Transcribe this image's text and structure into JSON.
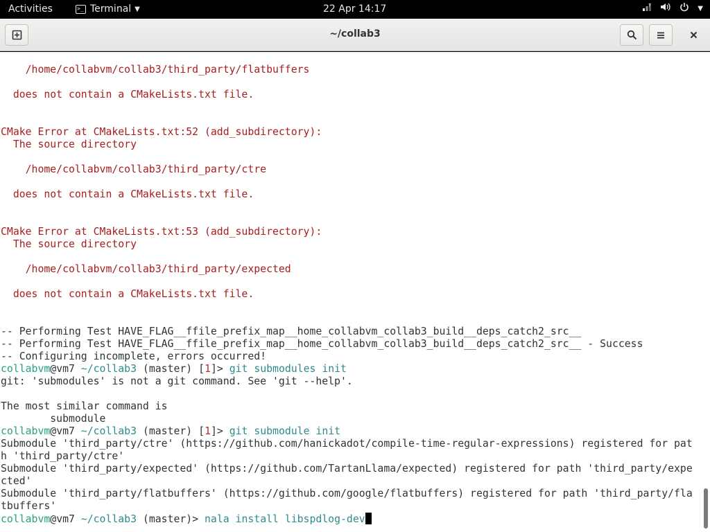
{
  "topbar": {
    "activities": "Activities",
    "app_menu_label": "Terminal",
    "clock": "22 Apr  14:17",
    "icons": [
      "network-icon",
      "volume-icon",
      "power-icon"
    ]
  },
  "window": {
    "title": "~/collab3"
  },
  "terminal": {
    "lines": [
      {
        "segs": [
          {
            "t": "    /home/collabvm/collab3/third_party/flatbuffers",
            "c": "err"
          }
        ]
      },
      {
        "segs": []
      },
      {
        "segs": [
          {
            "t": "  does not contain a CMakeLists.txt file.",
            "c": "err"
          }
        ]
      },
      {
        "segs": []
      },
      {
        "segs": []
      },
      {
        "segs": [
          {
            "t": "CMake Error at CMakeLists.txt:52 (add_subdirectory):",
            "c": "err"
          }
        ]
      },
      {
        "segs": [
          {
            "t": "  The source directory",
            "c": "err"
          }
        ]
      },
      {
        "segs": []
      },
      {
        "segs": [
          {
            "t": "    /home/collabvm/collab3/third_party/ctre",
            "c": "err"
          }
        ]
      },
      {
        "segs": []
      },
      {
        "segs": [
          {
            "t": "  does not contain a CMakeLists.txt file.",
            "c": "err"
          }
        ]
      },
      {
        "segs": []
      },
      {
        "segs": []
      },
      {
        "segs": [
          {
            "t": "CMake Error at CMakeLists.txt:53 (add_subdirectory):",
            "c": "err"
          }
        ]
      },
      {
        "segs": [
          {
            "t": "  The source directory",
            "c": "err"
          }
        ]
      },
      {
        "segs": []
      },
      {
        "segs": [
          {
            "t": "    /home/collabvm/collab3/third_party/expected",
            "c": "err"
          }
        ]
      },
      {
        "segs": []
      },
      {
        "segs": [
          {
            "t": "  does not contain a CMakeLists.txt file.",
            "c": "err"
          }
        ]
      },
      {
        "segs": []
      },
      {
        "segs": []
      },
      {
        "segs": [
          {
            "t": "-- Performing Test HAVE_FLAG__ffile_prefix_map__home_collabvm_collab3_build__deps_catch2_src__",
            "c": ""
          }
        ]
      },
      {
        "segs": [
          {
            "t": "-- Performing Test HAVE_FLAG__ffile_prefix_map__home_collabvm_collab3_build__deps_catch2_src__ - Success",
            "c": ""
          }
        ]
      },
      {
        "segs": [
          {
            "t": "-- Configuring incomplete, errors occurred!",
            "c": ""
          }
        ]
      },
      {
        "segs": [
          {
            "t": "collabvm",
            "c": "usr"
          },
          {
            "t": "@vm7 ",
            "c": ""
          },
          {
            "t": "~/collab3",
            "c": "dir"
          },
          {
            "t": " (master) ",
            "c": ""
          },
          {
            "t": "[",
            "c": ""
          },
          {
            "t": "1",
            "c": "code"
          },
          {
            "t": "]> ",
            "c": ""
          },
          {
            "t": "git submodules init",
            "c": "cmd"
          }
        ]
      },
      {
        "segs": [
          {
            "t": "git: 'submodules' is not a git command. See 'git --help'.",
            "c": ""
          }
        ]
      },
      {
        "segs": []
      },
      {
        "segs": [
          {
            "t": "The most similar command is",
            "c": ""
          }
        ]
      },
      {
        "segs": [
          {
            "t": "        submodule",
            "c": ""
          }
        ]
      },
      {
        "segs": [
          {
            "t": "collabvm",
            "c": "usr"
          },
          {
            "t": "@vm7 ",
            "c": ""
          },
          {
            "t": "~/collab3",
            "c": "dir"
          },
          {
            "t": " (master) ",
            "c": ""
          },
          {
            "t": "[",
            "c": ""
          },
          {
            "t": "1",
            "c": "code"
          },
          {
            "t": "]> ",
            "c": ""
          },
          {
            "t": "git submodule init",
            "c": "cmd"
          }
        ]
      },
      {
        "segs": [
          {
            "t": "Submodule 'third_party/ctre' (https://github.com/hanickadot/compile-time-regular-expressions) registered for pat",
            "c": ""
          }
        ]
      },
      {
        "segs": [
          {
            "t": "h 'third_party/ctre'",
            "c": ""
          }
        ]
      },
      {
        "segs": [
          {
            "t": "Submodule 'third_party/expected' (https://github.com/TartanLlama/expected) registered for path 'third_party/expe",
            "c": ""
          }
        ]
      },
      {
        "segs": [
          {
            "t": "cted'",
            "c": ""
          }
        ]
      },
      {
        "segs": [
          {
            "t": "Submodule 'third_party/flatbuffers' (https://github.com/google/flatbuffers) registered for path 'third_party/fla",
            "c": ""
          }
        ]
      },
      {
        "segs": [
          {
            "t": "tbuffers'",
            "c": ""
          }
        ]
      },
      {
        "segs": [
          {
            "t": "collabvm",
            "c": "usr"
          },
          {
            "t": "@vm7 ",
            "c": ""
          },
          {
            "t": "~/collab3",
            "c": "dir"
          },
          {
            "t": " (master)> ",
            "c": ""
          },
          {
            "t": "nala install libspdlog-dev",
            "c": "cmd"
          }
        ],
        "cursor": true
      }
    ]
  }
}
